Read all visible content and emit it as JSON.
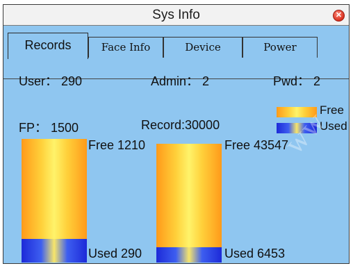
{
  "window": {
    "title": "Sys Info",
    "close_icon": "close-icon"
  },
  "tabs": [
    {
      "label": "Records",
      "active": true
    },
    {
      "label": "Face Info",
      "active": false
    },
    {
      "label": "Device",
      "active": false
    },
    {
      "label": "Power",
      "active": false
    }
  ],
  "stats": {
    "user": "User： 290",
    "admin": "Admin： 2",
    "pwd": "Pwd： 2",
    "fp": "FP： 1500",
    "record": "Record:30000"
  },
  "legend": {
    "free": "Free",
    "used": "Used"
  },
  "bars": [
    {
      "free_label": "Free 1210",
      "used_label": "Used 290",
      "used_fraction": 0.1933
    },
    {
      "free_label": "Free 43547",
      "used_label": "Used 6453",
      "used_fraction": 0.1291
    }
  ],
  "colors": {
    "background": "#8fc6f0",
    "free_main": "#ff9a1a",
    "free_highlight": "#fff36a",
    "used_main": "#1d2ad8"
  }
}
